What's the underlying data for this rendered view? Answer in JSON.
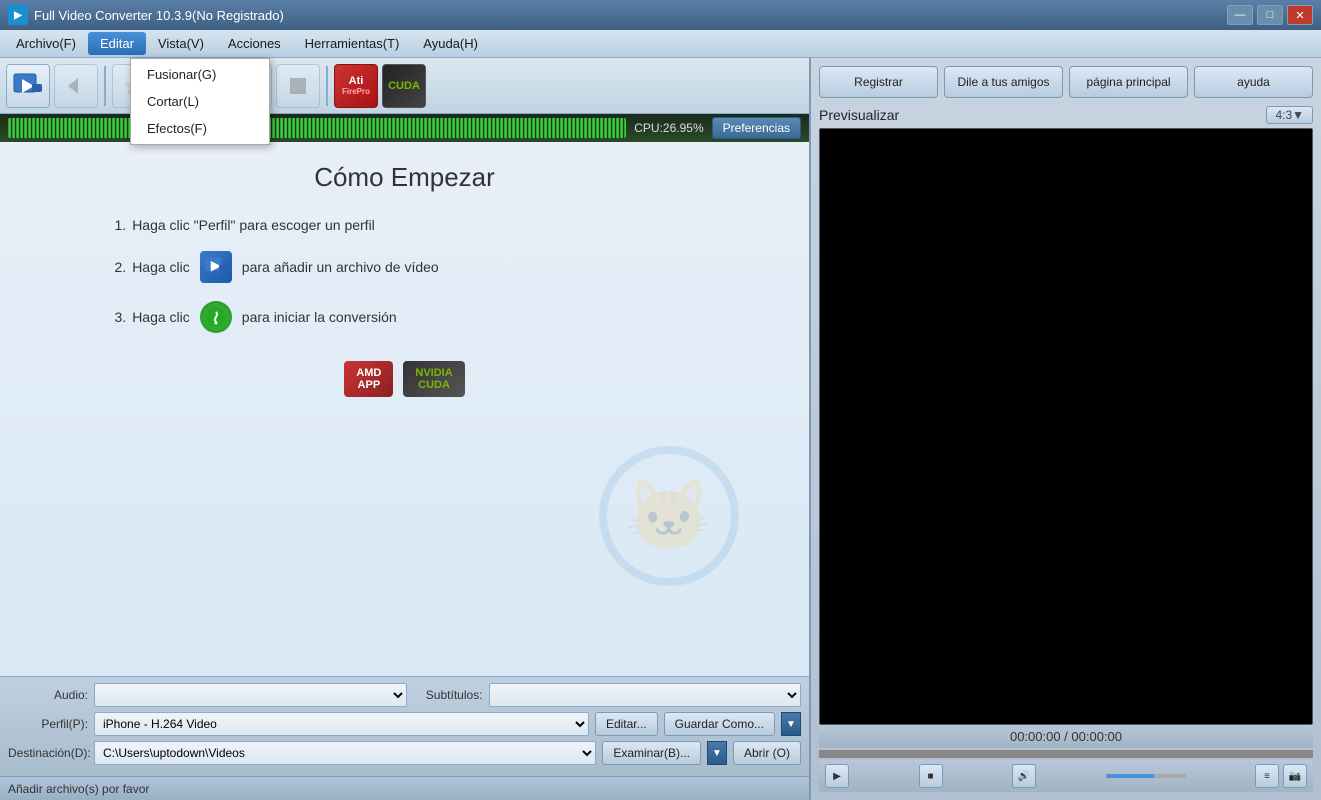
{
  "window": {
    "title": "Full Video Converter 10.3.9(No Registrado)",
    "controls": {
      "minimize": "—",
      "maximize": "□",
      "close": "✕"
    }
  },
  "menu": {
    "items": [
      {
        "id": "archivo",
        "label": "Archivo(F)"
      },
      {
        "id": "editar",
        "label": "Editar"
      },
      {
        "id": "vista",
        "label": "Vista(V)"
      },
      {
        "id": "acciones",
        "label": "Acciones"
      },
      {
        "id": "herramientas",
        "label": "Herramientas(T)"
      },
      {
        "id": "ayuda",
        "label": "Ayuda(H)"
      }
    ],
    "editar_dropdown": [
      {
        "id": "fusionar",
        "label": "Fusionar(G)"
      },
      {
        "id": "cortar",
        "label": "Cortar(L)"
      },
      {
        "id": "efectos",
        "label": "Efectos(F)"
      }
    ]
  },
  "toolbar": {
    "buttons": [
      "add-video",
      "arrow",
      "star",
      "rotate",
      "pause",
      "stop"
    ],
    "ati_label": "Ati",
    "cuda_label": "CUDA"
  },
  "waveform": {
    "cpu_label": "CPU:26.95%",
    "pref_label": "Preferencias"
  },
  "content": {
    "title": "Cómo Empezar",
    "steps": [
      {
        "number": "1.",
        "text": "Haga clic \"Perfil\" para escoger un perfil"
      },
      {
        "number": "2.",
        "text": "Haga clic",
        "suffix": "para añadir un archivo de vídeo"
      },
      {
        "number": "3.",
        "text": "Haga clic",
        "suffix": "para iniciar la conversión"
      }
    ],
    "badges": {
      "amd": {
        "line1": "AMD",
        "line2": "APP"
      },
      "nvidia": {
        "line1": "NVIDIA",
        "line2": "CUDA"
      }
    }
  },
  "bottom": {
    "audio_label": "Audio:",
    "subtitles_label": "Subtítulos:",
    "perfil_label": "Perfil(P):",
    "perfil_value": "iPhone - H.264 Video",
    "editar_btn": "Editar...",
    "guardar_btn": "Guardar Como...",
    "destino_label": "Destinación(D):",
    "destino_value": "C:\\Users\\uptodown\\Videos",
    "examinar_btn": "Examinar(B)...",
    "abrir_btn": "Abrir (O)",
    "status": "Añadir archivo(s) por favor"
  },
  "right_panel": {
    "register_btn": "Registrar",
    "friends_btn": "Dile a tus amigos",
    "home_btn": "página principal",
    "help_btn": "ayuda",
    "preview_label": "Previsualizar",
    "aspect_ratio": "4:3▼",
    "timecode": "00:00:00 / 00:00:00"
  }
}
